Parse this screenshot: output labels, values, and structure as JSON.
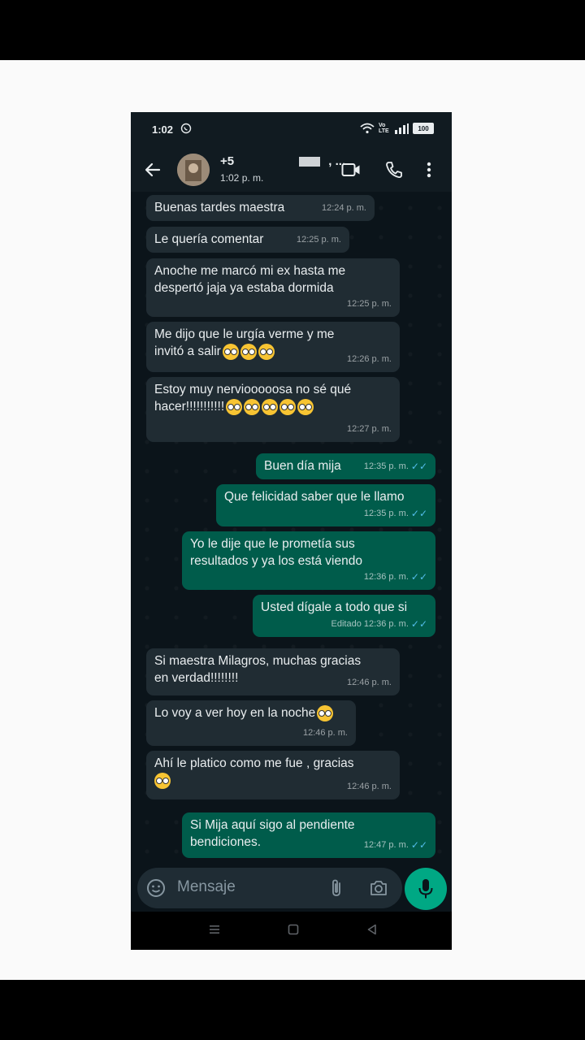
{
  "status": {
    "time": "1:02",
    "battery": "100",
    "network": "Vo LTE"
  },
  "header": {
    "contact_name": "+5",
    "contact_suffix": ", ...",
    "subtitle": "1:02 p. m."
  },
  "messages": [
    {
      "dir": "in",
      "text": "Buenas tardes maestra",
      "time": "12:24 p. m."
    },
    {
      "dir": "in",
      "text": "Le quería comentar",
      "time": "12:25 p. m."
    },
    {
      "dir": "in",
      "line1": "Anoche me marcó mi ex hasta me",
      "line2": "despertó jaja ya estaba dormida",
      "time": "12:25 p. m."
    },
    {
      "dir": "in",
      "line1": "Me dijo que le urgía verme y me",
      "line2": "invitó a salir",
      "time": "12:26 p. m."
    },
    {
      "dir": "in",
      "line1": "Estoy muy nerviooooosa no sé qué",
      "line2": "hacer!!!!!!!!!!!",
      "time": "12:27 p. m."
    },
    {
      "dir": "out",
      "text": "Buen día mija",
      "time": "12:35 p. m."
    },
    {
      "dir": "out",
      "text": "Que felicidad saber que le llamo",
      "time": "12:35 p. m."
    },
    {
      "dir": "out",
      "line1": "Yo le dije que le prometía sus",
      "line2": "resultados y ya los está viendo",
      "time": "12:36 p. m."
    },
    {
      "dir": "out",
      "text": "Usted dígale a todo que si",
      "edited": "Editado",
      "time": "12:36 p. m."
    },
    {
      "dir": "in",
      "line1": "Si maestra Milagros, muchas gracias",
      "line2": "en verdad!!!!!!!!",
      "time": "12:46 p. m."
    },
    {
      "dir": "in",
      "text": "Lo voy a ver hoy en la noche",
      "time": "12:46 p. m."
    },
    {
      "dir": "in",
      "line1": "Ahí le platico como me fue , gracias",
      "time": "12:46 p. m."
    },
    {
      "dir": "out",
      "line1": "Si Mija aquí sigo al pendiente",
      "line2": "bendiciones.",
      "time": "12:47 p. m."
    }
  ],
  "input": {
    "placeholder": "Mensaje"
  },
  "colors": {
    "incoming_bubble": "#202c33",
    "outgoing_bubble": "#005c4b",
    "accent": "#00a884",
    "read_ticks": "#53bdeb"
  }
}
